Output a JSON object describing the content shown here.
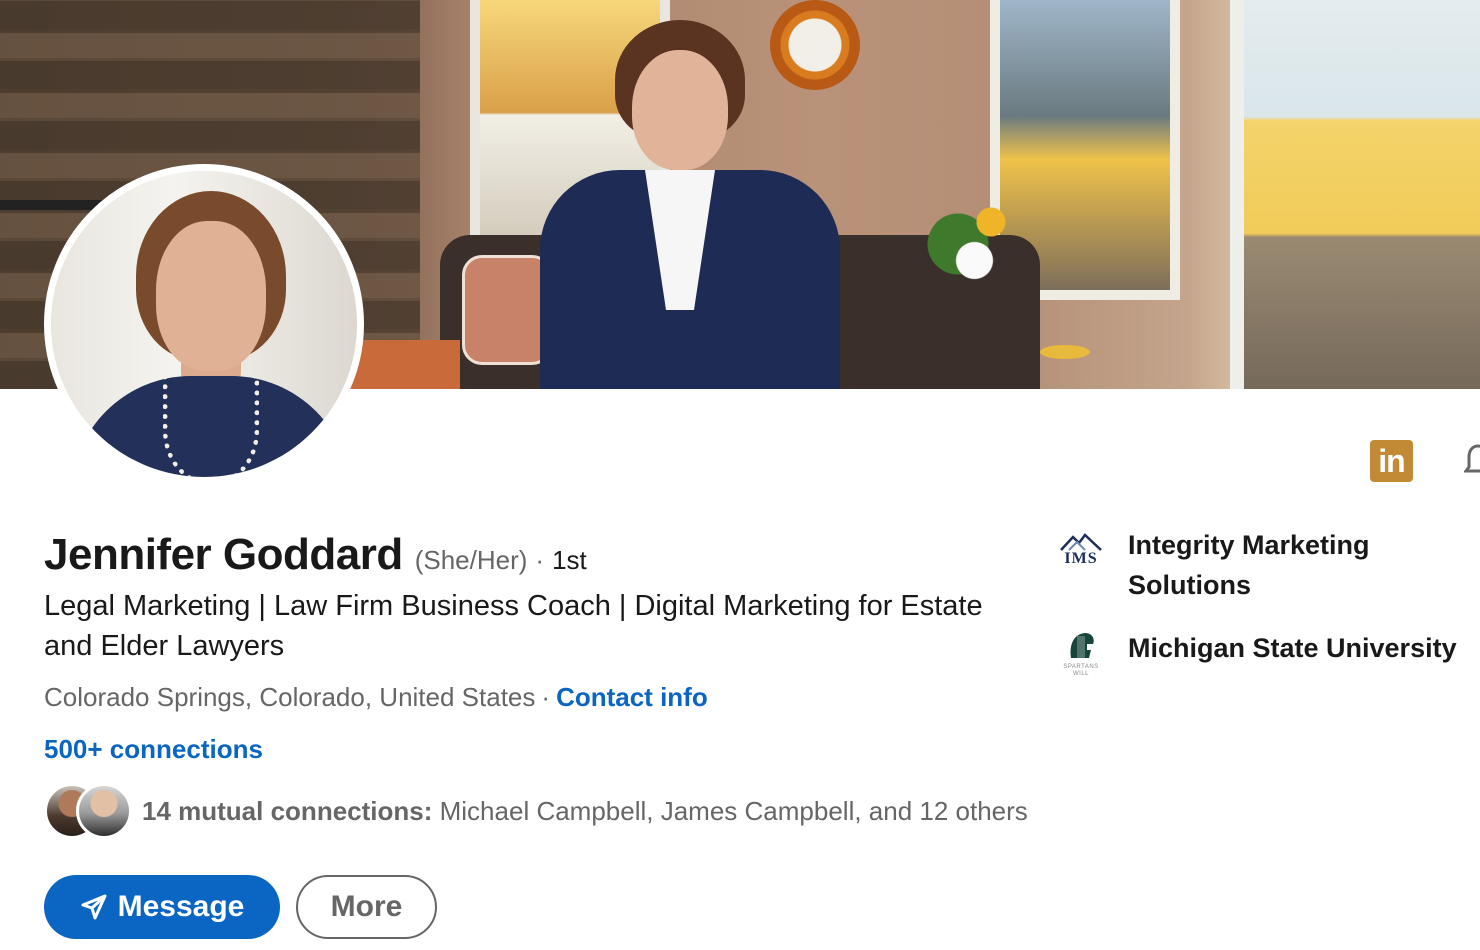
{
  "profile": {
    "name": "Jennifer Goddard",
    "pronouns": "(She/Her)",
    "degree_sep": "·",
    "degree": "1st",
    "headline": "Legal Marketing | Law Firm Business Coach | Digital Marketing for Estate and Elder Lawyers",
    "location": "Colorado Springs, Colorado, United States",
    "location_sep": "·",
    "contact_info_label": "Contact info",
    "connections_label": "500+ connections"
  },
  "mutual": {
    "count_label": "14 mutual connections:",
    "names_label": "Michael Campbell, James Campbell, and 12 others"
  },
  "actions": {
    "message_label": "Message",
    "more_label": "More"
  },
  "top_right": {
    "linkedin_badge": "in"
  },
  "experience": {
    "company": "Integrity Marketing Solutions",
    "logo_text": "IMS"
  },
  "education": {
    "school": "Michigan State University",
    "logo_text": "SPARTANS WILL"
  },
  "colors": {
    "accent": "#0a66c2",
    "premium_badge": "#c38a35",
    "text_primary": "#191919",
    "text_secondary": "#666666"
  },
  "icons": {
    "message_icon": "send-arrow-icon",
    "linkedin_icon": "linkedin-icon",
    "bell_icon": "bell-icon"
  }
}
